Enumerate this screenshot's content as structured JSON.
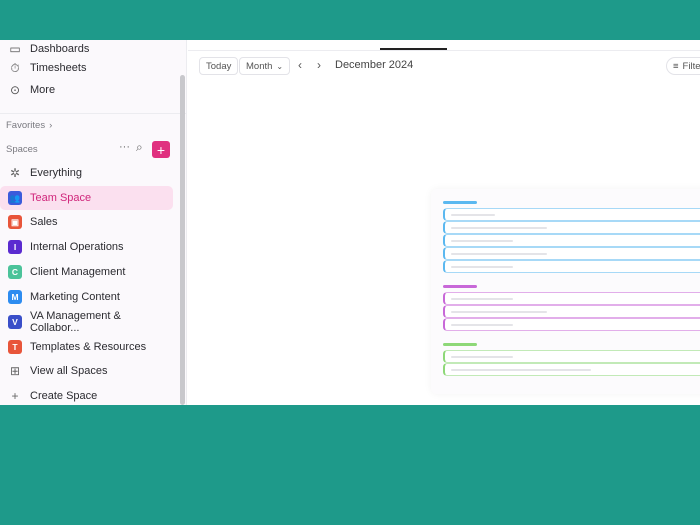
{
  "sidebar": {
    "nav": [
      {
        "label": "Dashboards",
        "icon": "dashboard-icon"
      },
      {
        "label": "Timesheets",
        "icon": "timer-icon"
      },
      {
        "label": "More",
        "icon": "more-icon"
      }
    ],
    "favorites_label": "Favorites",
    "spaces_label": "Spaces",
    "everything_label": "Everything",
    "spaces": [
      {
        "label": "Team Space",
        "letter": "",
        "color": "#3b5bdb",
        "active": true
      },
      {
        "label": "Sales",
        "letter": "",
        "color": "#e8553a"
      },
      {
        "label": "Internal Operations",
        "letter": "I",
        "color": "#5b2bd0"
      },
      {
        "label": "Client Management",
        "letter": "C",
        "color": "#4cc39a"
      },
      {
        "label": "Marketing Content",
        "letter": "M",
        "color": "#2d8cf0"
      },
      {
        "label": "VA Management & Collabor...",
        "letter": "V",
        "color": "#3a4fc9"
      },
      {
        "label": "Templates & Resources",
        "letter": "T",
        "color": "#e8553a"
      }
    ],
    "view_all_label": "View all Spaces",
    "create_label": "Create Space"
  },
  "toolbar": {
    "today_label": "Today",
    "month_label": "Month",
    "period": "December 2024",
    "filter_label": "Filters"
  },
  "accent": "#e0307f",
  "groups": [
    {
      "color": "#5bb8f0",
      "rows": 5
    },
    {
      "color": "#c868d8",
      "rows": 3
    },
    {
      "color": "#8ed878",
      "rows": 2
    }
  ]
}
